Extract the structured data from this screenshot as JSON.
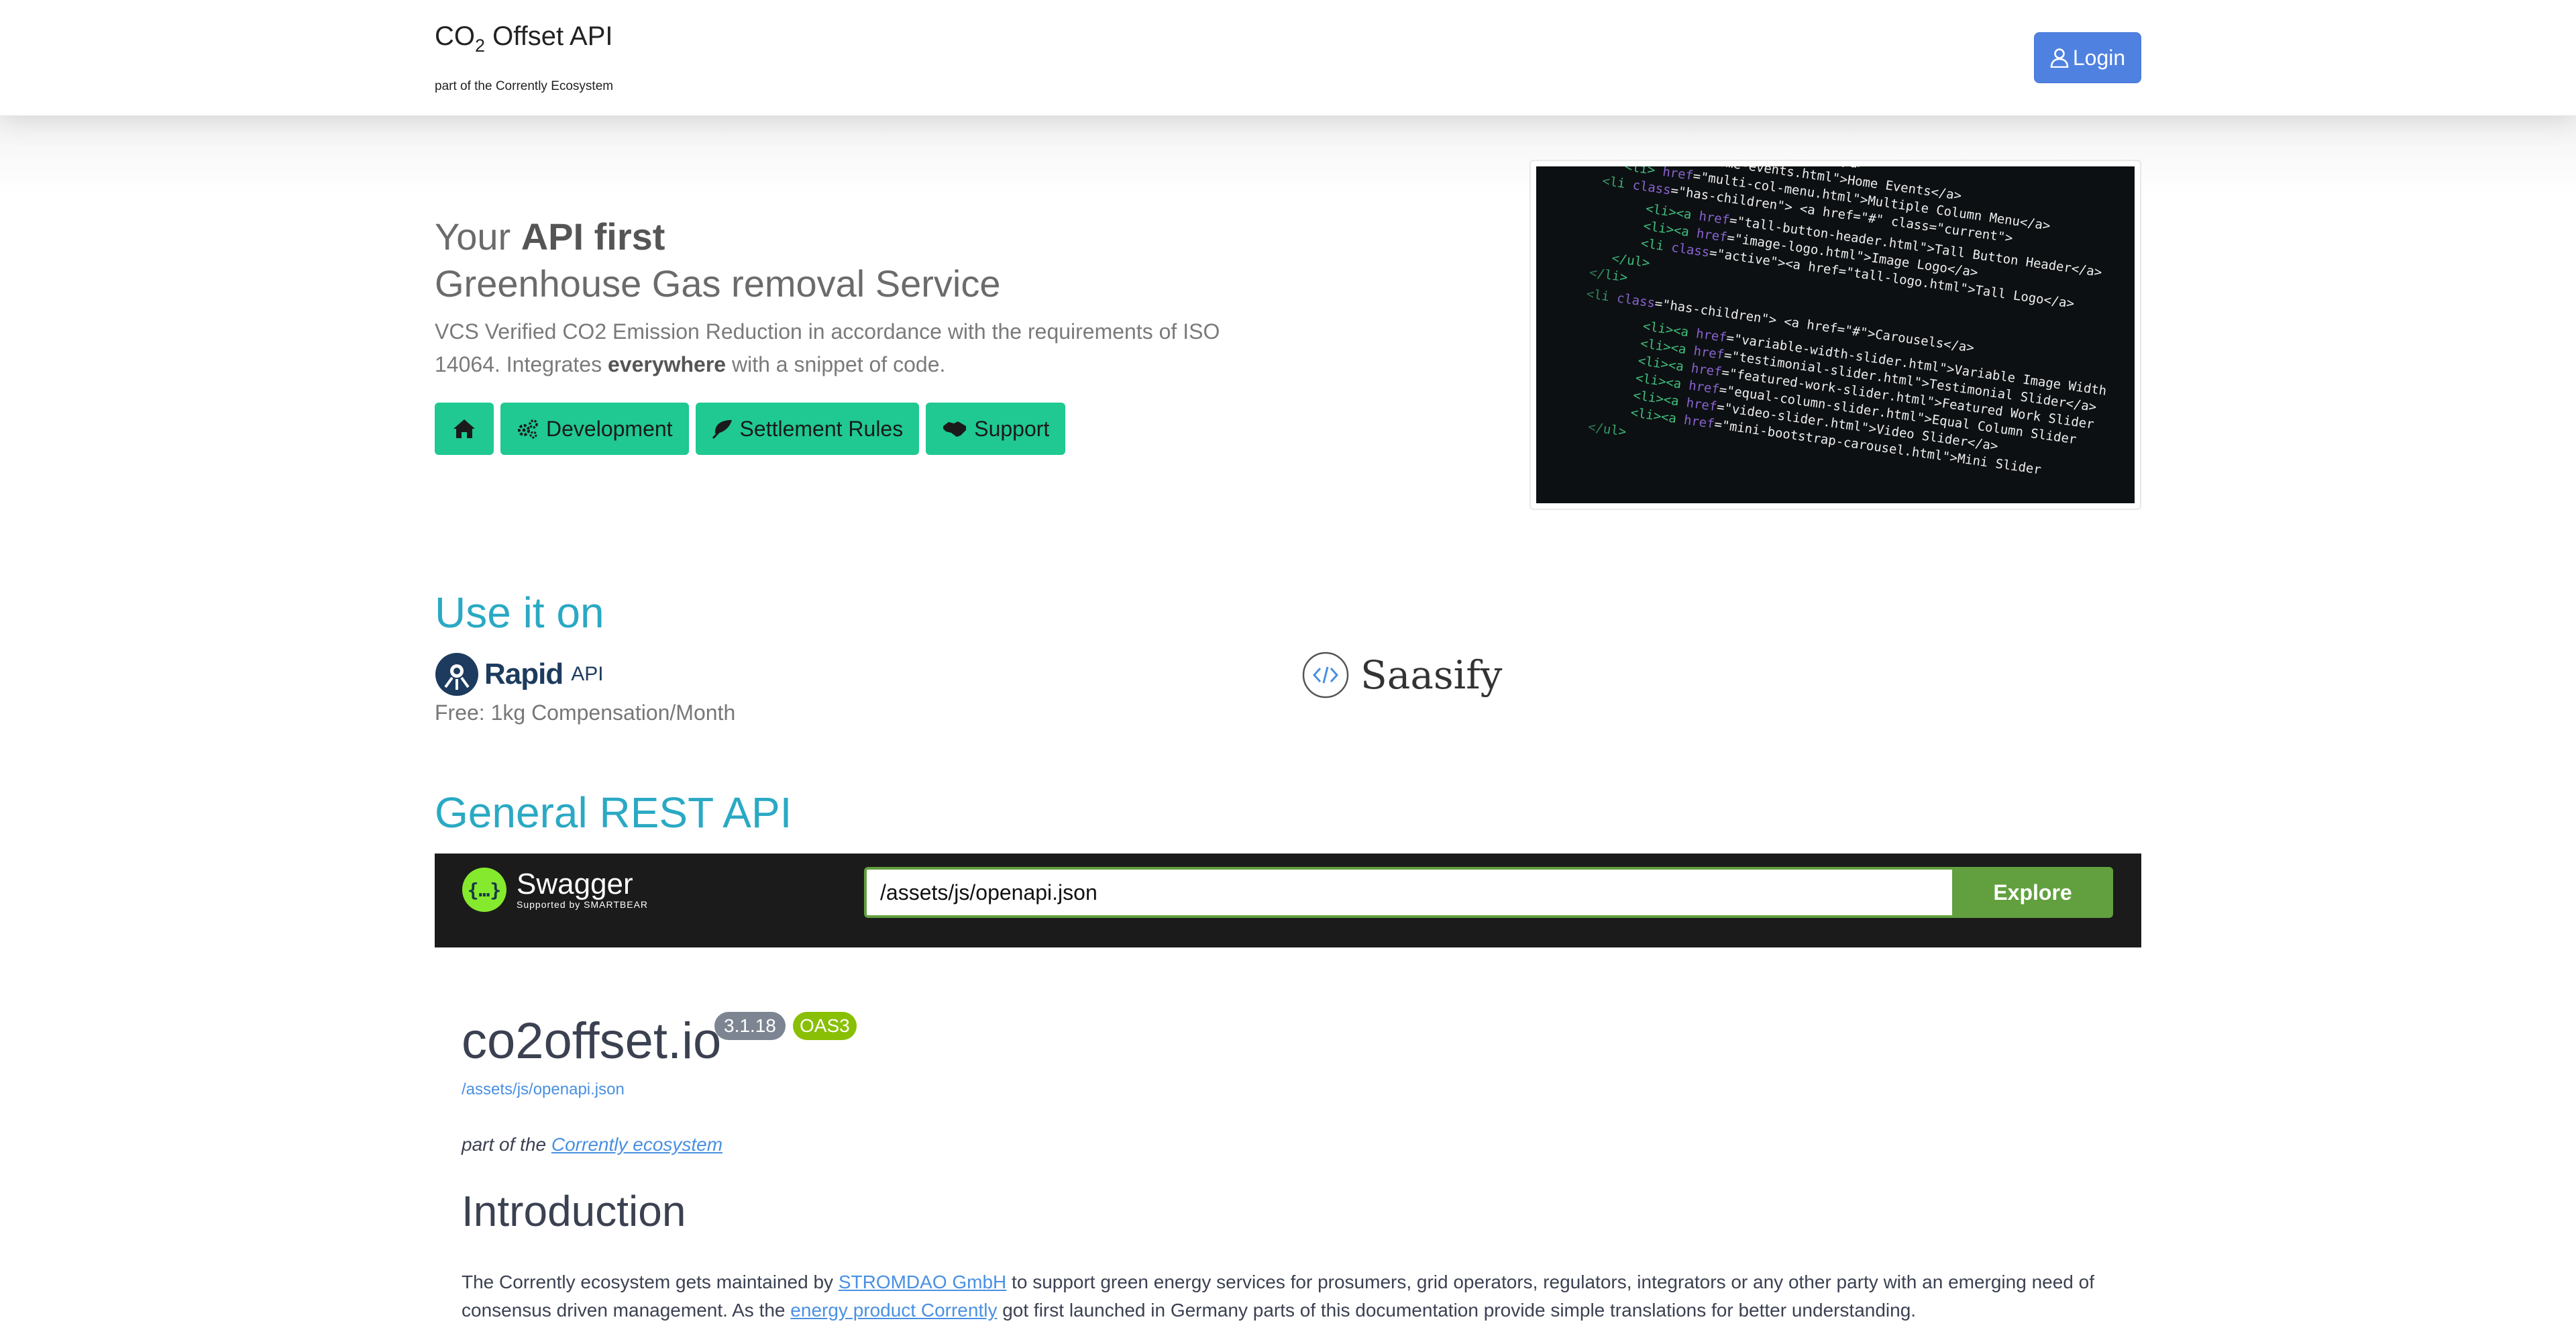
{
  "nav": {
    "brand_prefix": "CO",
    "brand_sub_digit": "2",
    "brand_suffix": " Offset API",
    "brand_tagline": "part of the Corrently Ecosystem",
    "login_label": "Login"
  },
  "hero": {
    "title_prefix": "Your ",
    "title_bold": "API first",
    "subtitle": "Greenhouse Gas removal Service",
    "desc_part1": "VCS Verified CO2 Emission Reduction in accordance with the requirements of ISO 14064. Integrates ",
    "desc_bold": "everywhere",
    "desc_part2": " with a snippet of code.",
    "buttons": {
      "development": "Development",
      "settlement": "Settlement Rules",
      "support": "Support"
    }
  },
  "use_it_on": {
    "heading": "Use it on",
    "rapid_name": "Rapid",
    "rapid_suffix": "API",
    "rapid_note": "Free: 1kg Compensation/Month",
    "saasify_name": "Saasify"
  },
  "rest": {
    "heading": "General REST API"
  },
  "swagger": {
    "logo_text": "Swagger",
    "supported_by": "Supported by SMARTBEAR",
    "url_value": "/assets/js/openapi.json",
    "explore_label": "Explore"
  },
  "api_info": {
    "title": "co2offset.io",
    "version_badge": "3.1.18",
    "oas_badge": "OAS3",
    "spec_link": "/assets/js/openapi.json",
    "part_of_prefix": "part of the ",
    "part_of_link": "Corrently ecosystem",
    "intro_heading": "Introduction",
    "intro_1": "The Corrently ecosystem gets maintained by ",
    "intro_link1": "STROMDAO GmbH",
    "intro_2": " to support green energy services for prosumers, grid operators, regulators, integrators or any other party with an emerging need of consensus driven management. As the ",
    "intro_link2": "energy product Corrently",
    "intro_3": " got first launched in Germany parts of this documentation provide simple translations for better understanding."
  },
  "colors": {
    "accent_green": "#1fc991",
    "section_heading": "#2aa9c4",
    "login_blue": "#4f81e0",
    "swagger_green": "#62a03f"
  },
  "icons": {
    "home": "home-icon",
    "development": "gears-icon",
    "settlement": "leaf-icon",
    "support": "handshake-icon",
    "login": "user-icon"
  }
}
